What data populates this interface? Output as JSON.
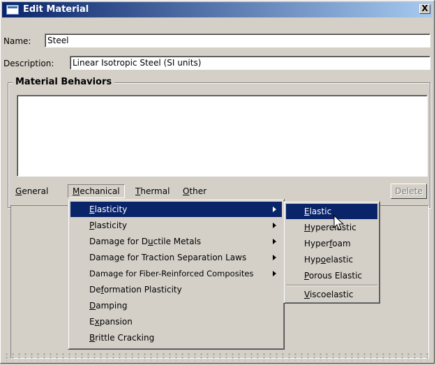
{
  "window": {
    "title": "Edit Material",
    "close_label": "X"
  },
  "form": {
    "name_label": "Name:",
    "name_value": "Steel",
    "description_label": "Description:",
    "description_value": "Linear Isotropic Steel (SI units)"
  },
  "behaviors": {
    "title": "Material Behaviors"
  },
  "menubar": {
    "items": [
      {
        "label": "General",
        "mnemonic": "G",
        "rest": "eneral"
      },
      {
        "label": "Mechanical",
        "mnemonic": "M",
        "rest": "echanical"
      },
      {
        "label": "Thermal",
        "mnemonic": "T",
        "rest": "hermal"
      },
      {
        "label": "Other",
        "mnemonic": "O",
        "rest": "ther"
      }
    ],
    "delete_label": "Delete"
  },
  "mechanical_menu": {
    "items": [
      {
        "label": "Elasticity",
        "pre": "",
        "mnemonic": "E",
        "post": "lasticity",
        "submenu": true,
        "highlighted": true
      },
      {
        "label": "Plasticity",
        "pre": "",
        "mnemonic": "P",
        "post": "lasticity",
        "submenu": true
      },
      {
        "label": "Damage for Ductile Metals",
        "pre": "Damage for D",
        "mnemonic": "u",
        "post": "ctile Metals",
        "submenu": true
      },
      {
        "label": "Damage for Traction Separation Laws",
        "pre": "Dama",
        "mnemonic": "g",
        "post": "e for Traction Separation Laws",
        "submenu": true
      },
      {
        "label": "Damage for Fiber-Reinforced Composites",
        "pre": "Damage for Fiber-Reinforced Composites",
        "mnemonic": "",
        "post": "",
        "submenu": true
      },
      {
        "label": "Deformation Plasticity",
        "pre": "De",
        "mnemonic": "f",
        "post": "ormation Plasticity",
        "submenu": false
      },
      {
        "label": "Damping",
        "pre": "",
        "mnemonic": "D",
        "post": "amping",
        "submenu": false
      },
      {
        "label": "Expansion",
        "pre": "E",
        "mnemonic": "x",
        "post": "pansion",
        "submenu": false
      },
      {
        "label": "Brittle Cracking",
        "pre": "",
        "mnemonic": "B",
        "post": "rittle Cracking",
        "submenu": false
      }
    ]
  },
  "elasticity_menu": {
    "items": [
      {
        "label": "Elastic",
        "pre": "",
        "mnemonic": "E",
        "post": "lastic",
        "highlighted": true
      },
      {
        "label": "Hyperelastic",
        "pre": "",
        "mnemonic": "H",
        "post": "yperelastic"
      },
      {
        "label": "Hyperfoam",
        "pre": "Hyper",
        "mnemonic": "f",
        "post": "oam"
      },
      {
        "label": "Hypoelastic",
        "pre": "Hyp",
        "mnemonic": "o",
        "post": "elastic"
      },
      {
        "label": "Porous Elastic",
        "pre": "",
        "mnemonic": "P",
        "post": "orous Elastic"
      },
      {
        "label": "Viscoelastic",
        "pre": "",
        "mnemonic": "V",
        "post": "iscoelastic"
      }
    ]
  },
  "colors": {
    "face": "#d4d0c8",
    "highlight": "#0a246a",
    "title_gradient_end": "#a6caf0"
  },
  "icons": {
    "window": "window-icon",
    "close": "close-icon",
    "submenu": "submenu-arrow-icon",
    "cursor": "mouse-pointer-icon"
  }
}
